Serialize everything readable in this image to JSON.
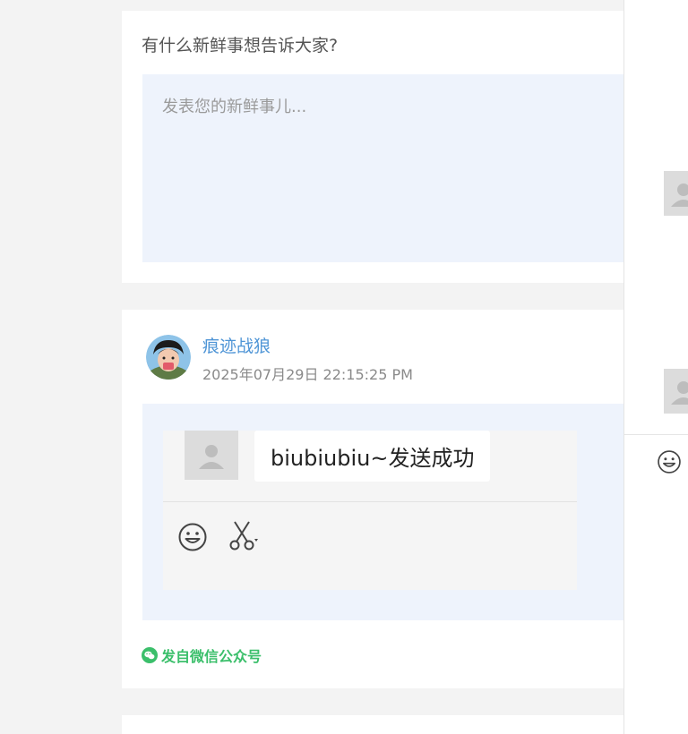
{
  "compose": {
    "title": "有什么新鲜事想告诉大家?",
    "placeholder": "发表您的新鲜事儿..."
  },
  "post": {
    "author": "痕迹战狼",
    "timestamp": "2025年07月29日 22:15:25 PM",
    "screenshot": {
      "message": "biubiubiu~发送成功",
      "toolbar_icons": [
        "smile-emoji-icon",
        "scissors-icon"
      ]
    },
    "source": "发自微信公众号",
    "source_icon": "wechat-icon"
  },
  "colors": {
    "author_link": "#4f95d6",
    "source_green": "#3bbf6b",
    "content_background": "#eef3fc",
    "page_background": "#f3f3f3"
  }
}
